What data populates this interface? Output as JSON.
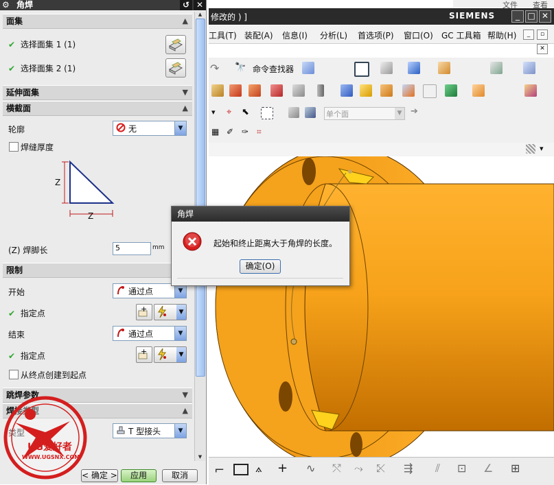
{
  "panel": {
    "title": "角焊",
    "sections": {
      "faces": "面集",
      "extend": "延伸面集",
      "cross": "横截面",
      "limits": "限制",
      "skip": "跳焊参数",
      "weld_type": "焊接类型"
    },
    "face1_label": "选择面集 1 (1)",
    "face2_label": "选择面集 2 (1)",
    "profile_label": "轮廓",
    "profile_value": "无",
    "seam_label": "焊缝厚度",
    "diagram_z": "Z",
    "leg_label": "(Z) 焊脚长",
    "leg_value": "5",
    "leg_unit": "mm",
    "start_label": "开始",
    "start_value": "通过点",
    "start_point_label": "指定点",
    "end_label": "结束",
    "end_value": "通过点",
    "end_point_label": "指定点",
    "create_from_end": "从终点创建到起点",
    "type_label": "类型",
    "type_value": "T 型接头",
    "ok_button": "< 确定 >",
    "apply_button": "应用",
    "cancel_button": "取消"
  },
  "nx": {
    "title_left": "修改的 ) ]",
    "brand": "SIEMENS",
    "top_menu": [
      "文件",
      "查看"
    ],
    "menu": [
      "工具(T)",
      "装配(A)",
      "信息(I)",
      "分析(L)",
      "首选项(P)",
      "窗口(O)",
      "GC 工具箱",
      "帮助(H)"
    ],
    "command_finder": "命令查找器",
    "filter_value": "单个面"
  },
  "error_dialog": {
    "title": "角焊",
    "message": "起始和终止距离大于角焊的长度。",
    "ok": "确定(O)"
  },
  "watermark": {
    "brand": "UG爱好者",
    "url": "WWW.UGSNX.COM"
  },
  "colors": {
    "model_orange": "#f7a21a",
    "error_red": "#d81e1e",
    "check_green": "#2ea62e"
  }
}
